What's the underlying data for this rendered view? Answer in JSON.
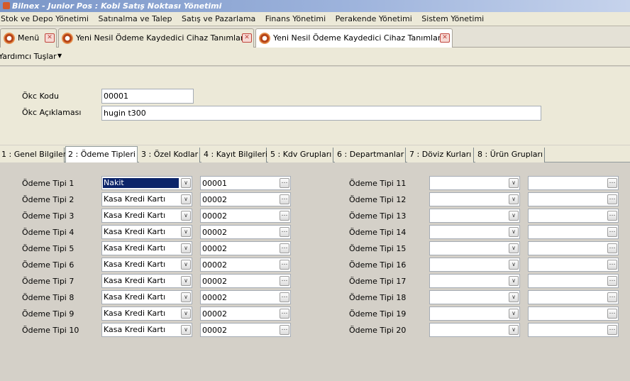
{
  "window": {
    "title": "Bilnex - Junior Pos : Kobi Satış Noktası Yönetimi"
  },
  "menu": [
    "Stok ve Depo Yönetimi",
    "Satınalma ve Talep",
    "Satış ve Pazarlama",
    "Finans Yönetimi",
    "Perakende Yönetimi",
    "Sistem Yönetimi"
  ],
  "doc_tabs": [
    {
      "label": "Menü"
    },
    {
      "label": "Yeni Nesil Ödeme Kaydedici Cihaz Tanımları"
    },
    {
      "label": "Yeni Nesil Ödeme Kaydedici Cihaz Tanımları"
    }
  ],
  "toolbar": {
    "help_keys": "Yardımcı Tuşlar"
  },
  "form": {
    "okc_kodu_label": "Ökc Kodu",
    "okc_kodu_value": "00001",
    "okc_aciklama_label": "Ökc Açıklaması",
    "okc_aciklama_value": "hugin t300"
  },
  "page_tabs": [
    "1 : Genel Bilgiler",
    "2 : Ödeme Tipleri",
    "3 : Özel Kodlar",
    "4 : Kayıt Bilgileri",
    "5 : Kdv Grupları",
    "6 : Departmanlar",
    "7 : Döviz Kurları",
    "8 : Ürün Grupları"
  ],
  "active_page_tab": 1,
  "payment_types": [
    {
      "label": "Ödeme Tipi 1",
      "type": "Nakit",
      "code": "00001",
      "selected": true
    },
    {
      "label": "Ödeme Tipi 2",
      "type": "Kasa Kredi Kartı",
      "code": "00002"
    },
    {
      "label": "Ödeme Tipi 3",
      "type": "Kasa Kredi Kartı",
      "code": "00002"
    },
    {
      "label": "Ödeme Tipi 4",
      "type": "Kasa Kredi Kartı",
      "code": "00002"
    },
    {
      "label": "Ödeme Tipi 5",
      "type": "Kasa Kredi Kartı",
      "code": "00002"
    },
    {
      "label": "Ödeme Tipi 6",
      "type": "Kasa Kredi Kartı",
      "code": "00002"
    },
    {
      "label": "Ödeme Tipi 7",
      "type": "Kasa Kredi Kartı",
      "code": "00002"
    },
    {
      "label": "Ödeme Tipi 8",
      "type": "Kasa Kredi Kartı",
      "code": "00002"
    },
    {
      "label": "Ödeme Tipi 9",
      "type": "Kasa Kredi Kartı",
      "code": "00002"
    },
    {
      "label": "Ödeme Tipi 10",
      "type": "Kasa Kredi Kartı",
      "code": "00002"
    },
    {
      "label": "Ödeme Tipi 11",
      "type": "",
      "code": ""
    },
    {
      "label": "Ödeme Tipi 12",
      "type": "",
      "code": ""
    },
    {
      "label": "Ödeme Tipi 13",
      "type": "",
      "code": ""
    },
    {
      "label": "Ödeme Tipi 14",
      "type": "",
      "code": ""
    },
    {
      "label": "Ödeme Tipi 15",
      "type": "",
      "code": ""
    },
    {
      "label": "Ödeme Tipi 16",
      "type": "",
      "code": ""
    },
    {
      "label": "Ödeme Tipi 17",
      "type": "",
      "code": ""
    },
    {
      "label": "Ödeme Tipi 18",
      "type": "",
      "code": ""
    },
    {
      "label": "Ödeme Tipi 19",
      "type": "",
      "code": ""
    },
    {
      "label": "Ödeme Tipi 20",
      "type": "",
      "code": ""
    }
  ],
  "colors": {
    "selection": "#0b246a",
    "title_gradient_start": "#7a96c8",
    "close_icon": "#c0453c",
    "panel": "#d4d0c8"
  },
  "icons": {
    "dropdown": "chevron-down-icon",
    "lookup": "ellipsis-icon",
    "close": "close-icon",
    "logo": "bilnex-logo-icon"
  }
}
